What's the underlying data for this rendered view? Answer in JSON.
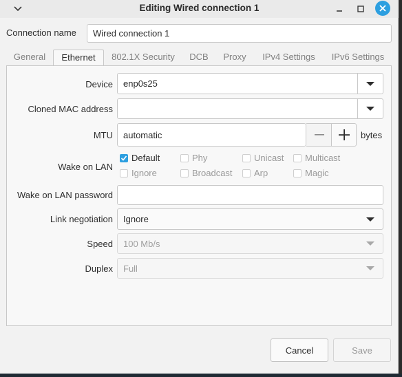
{
  "window": {
    "title": "Editing Wired connection 1"
  },
  "connection_name": {
    "label": "Connection name",
    "value": "Wired connection 1"
  },
  "tabs": [
    {
      "label": "General"
    },
    {
      "label": "Ethernet"
    },
    {
      "label": "802.1X Security"
    },
    {
      "label": "DCB"
    },
    {
      "label": "Proxy"
    },
    {
      "label": "IPv4 Settings"
    },
    {
      "label": "IPv6 Settings"
    }
  ],
  "active_tab": "Ethernet",
  "ethernet": {
    "device": {
      "label": "Device",
      "value": "enp0s25"
    },
    "cloned_mac": {
      "label": "Cloned MAC address",
      "value": ""
    },
    "mtu": {
      "label": "MTU",
      "value": "automatic",
      "unit": "bytes"
    },
    "wake_on_lan": {
      "label": "Wake on LAN",
      "options": [
        {
          "label": "Default",
          "checked": true
        },
        {
          "label": "Phy",
          "checked": false
        },
        {
          "label": "Unicast",
          "checked": false
        },
        {
          "label": "Multicast",
          "checked": false
        },
        {
          "label": "Ignore",
          "checked": false
        },
        {
          "label": "Broadcast",
          "checked": false
        },
        {
          "label": "Arp",
          "checked": false
        },
        {
          "label": "Magic",
          "checked": false
        }
      ]
    },
    "wol_password": {
      "label": "Wake on LAN password",
      "value": ""
    },
    "link_negotiation": {
      "label": "Link negotiation",
      "value": "Ignore"
    },
    "speed": {
      "label": "Speed",
      "value": "100 Mb/s"
    },
    "duplex": {
      "label": "Duplex",
      "value": "Full"
    }
  },
  "buttons": {
    "cancel": "Cancel",
    "save": "Save"
  },
  "colors": {
    "accent": "#2d9fe0"
  }
}
